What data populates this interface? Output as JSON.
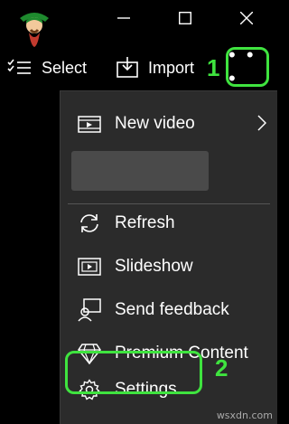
{
  "toolbar": {
    "select_label": "Select",
    "import_label": "Import",
    "more_label": "• • •"
  },
  "annotations": {
    "step1": "1",
    "step2": "2"
  },
  "menu": {
    "new_video": "New video",
    "refresh": "Refresh",
    "slideshow": "Slideshow",
    "send_feedback": "Send feedback",
    "premium_content": "Premium Content",
    "settings": "Settings"
  },
  "watermark": "wsxdn.com",
  "colors": {
    "highlight": "#3fe33f",
    "menu_bg": "#2b2b2b",
    "background": "#000000"
  }
}
